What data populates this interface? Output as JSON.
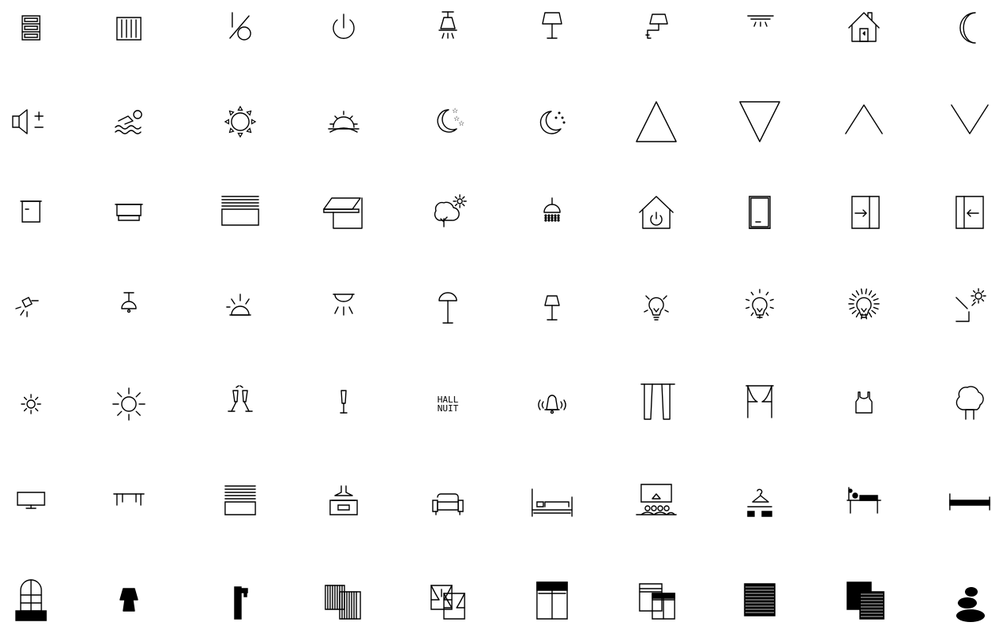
{
  "colors": {
    "stroke": "#000000",
    "background": "#ffffff"
  },
  "icons": [
    {
      "name": "shutter-panel-icon"
    },
    {
      "name": "radiator-icon"
    },
    {
      "name": "percent-icon"
    },
    {
      "name": "power-icon"
    },
    {
      "name": "ceiling-lamp-icon"
    },
    {
      "name": "table-lamp-icon"
    },
    {
      "name": "wall-lamp-icon"
    },
    {
      "name": "ceiling-light-bar-icon"
    },
    {
      "name": "house-door-icon"
    },
    {
      "name": "crescent-moon-icon"
    },
    {
      "name": "volume-plus-minus-icon"
    },
    {
      "name": "swimmer-icon"
    },
    {
      "name": "sun-icon"
    },
    {
      "name": "sunrise-icon"
    },
    {
      "name": "moon-stars-icon"
    },
    {
      "name": "moon-night-icon"
    },
    {
      "name": "triangle-up-icon"
    },
    {
      "name": "triangle-down-icon"
    },
    {
      "name": "chevron-up-icon"
    },
    {
      "name": "chevron-down-icon"
    },
    {
      "name": "blind-small-icon"
    },
    {
      "name": "blind-box-icon"
    },
    {
      "name": "roller-shutter-icon"
    },
    {
      "name": "awning-icon"
    },
    {
      "name": "tree-sun-icon"
    },
    {
      "name": "shower-icon"
    },
    {
      "name": "house-power-icon"
    },
    {
      "name": "door-icon"
    },
    {
      "name": "sliding-door-right-icon"
    },
    {
      "name": "sliding-door-left-icon"
    },
    {
      "name": "spotlight-icon"
    },
    {
      "name": "pendant-lamp-icon"
    },
    {
      "name": "dome-light-icon"
    },
    {
      "name": "ceiling-spot-icon"
    },
    {
      "name": "floor-lamp-umbrella-icon"
    },
    {
      "name": "floor-lamp-icon"
    },
    {
      "name": "bulb-icon"
    },
    {
      "name": "bulb-bright-icon"
    },
    {
      "name": "bulb-brightest-icon"
    },
    {
      "name": "outdoor-light-icon"
    },
    {
      "name": "sun-small-icon"
    },
    {
      "name": "sun-large-icon"
    },
    {
      "name": "champagne-toast-icon"
    },
    {
      "name": "champagne-glass-icon"
    },
    {
      "name": "hall-nuit-label",
      "text": "HALL\nNUIT"
    },
    {
      "name": "bell-ringing-icon"
    },
    {
      "name": "curtains-closed-icon"
    },
    {
      "name": "curtains-open-icon"
    },
    {
      "name": "tank-top-icon"
    },
    {
      "name": "tree-icon"
    },
    {
      "name": "tv-icon"
    },
    {
      "name": "table-icon"
    },
    {
      "name": "shutter-half-icon"
    },
    {
      "name": "kitchen-hood-icon"
    },
    {
      "name": "armchair-icon"
    },
    {
      "name": "bed-icon"
    },
    {
      "name": "cinema-icon"
    },
    {
      "name": "wardrobe-icon"
    },
    {
      "name": "massage-table-icon"
    },
    {
      "name": "bed-simple-icon"
    },
    {
      "name": "balcony-window-icon"
    },
    {
      "name": "lamp-solid-icon"
    },
    {
      "name": "tap-icon"
    },
    {
      "name": "sheer-curtains-icon"
    },
    {
      "name": "curtain-window-icon"
    },
    {
      "name": "window-shutter-icon"
    },
    {
      "name": "windows-pair-icon"
    },
    {
      "name": "shutter-closed-icon"
    },
    {
      "name": "shutters-pair-icon"
    },
    {
      "name": "stones-icon"
    }
  ]
}
